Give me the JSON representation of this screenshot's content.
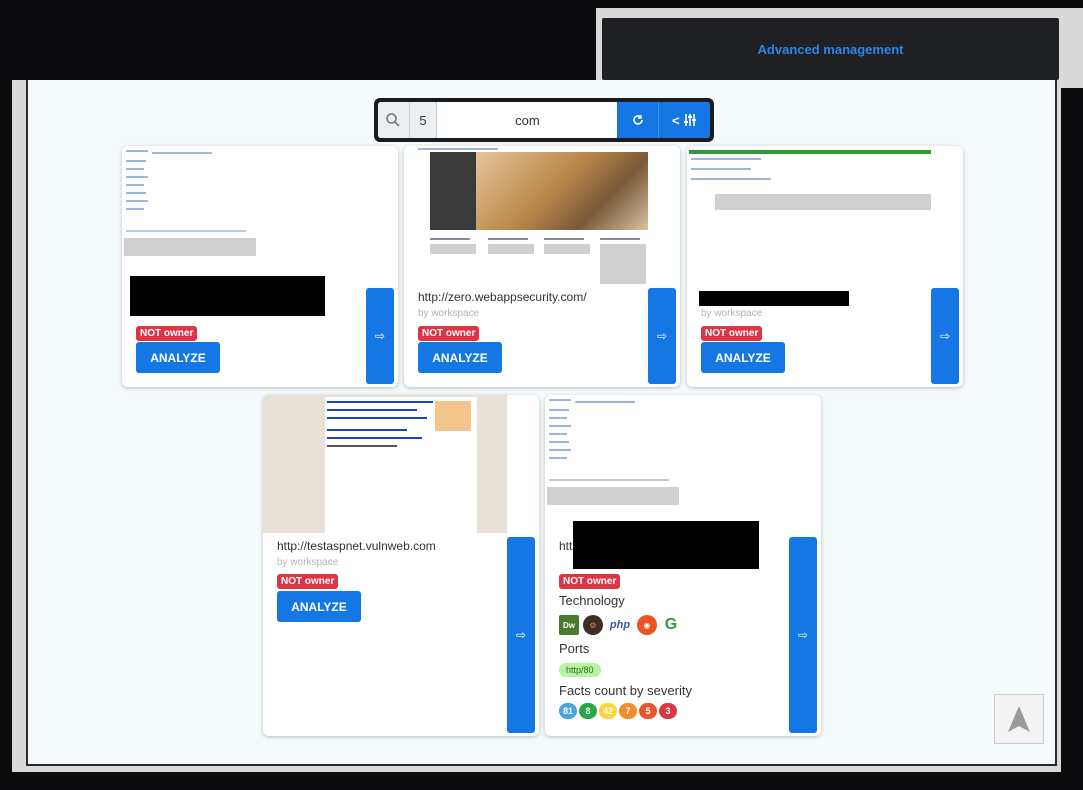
{
  "header": {
    "advanced_link": "Advanced management"
  },
  "search": {
    "count": "5",
    "query": "com",
    "refresh_icon": "refresh-icon",
    "filter_label": "<",
    "filter_icon": "sliders-icon"
  },
  "cards": [
    {
      "url": "",
      "by": "",
      "badge": "NOT owner",
      "analyze": "ANALYZE"
    },
    {
      "url": "http://zero.webappsecurity.com/",
      "by": "by workspace",
      "badge": "NOT owner",
      "analyze": "ANALYZE"
    },
    {
      "url": "",
      "by": "by workspace",
      "badge": "NOT owner",
      "analyze": "ANALYZE"
    },
    {
      "url": "http://testaspnet.vulnweb.com",
      "by": "by workspace",
      "badge": "NOT owner",
      "analyze": "ANALYZE"
    },
    {
      "url": "htt",
      "badge": "NOT owner",
      "technology_label": "Technology",
      "technologies": [
        {
          "name": "Dw",
          "color": "#4a7a2c"
        },
        {
          "name": "",
          "color": "#3a2f2a"
        },
        {
          "name": "php",
          "color": "#ffffff"
        },
        {
          "name": "",
          "color": "#e95420"
        },
        {
          "name": "",
          "color": "#2e9a3a"
        }
      ],
      "ports_label": "Ports",
      "ports": [
        "http/80"
      ],
      "facts_label": "Facts count by severity",
      "severities": [
        {
          "value": "81",
          "color": "#4aa3df"
        },
        {
          "value": "8",
          "color": "#28a745"
        },
        {
          "value": "42",
          "color": "#ffd43b"
        },
        {
          "value": "7",
          "color": "#f08c2b"
        },
        {
          "value": "5",
          "color": "#e4572e"
        },
        {
          "value": "3",
          "color": "#dc3545"
        }
      ]
    }
  ]
}
